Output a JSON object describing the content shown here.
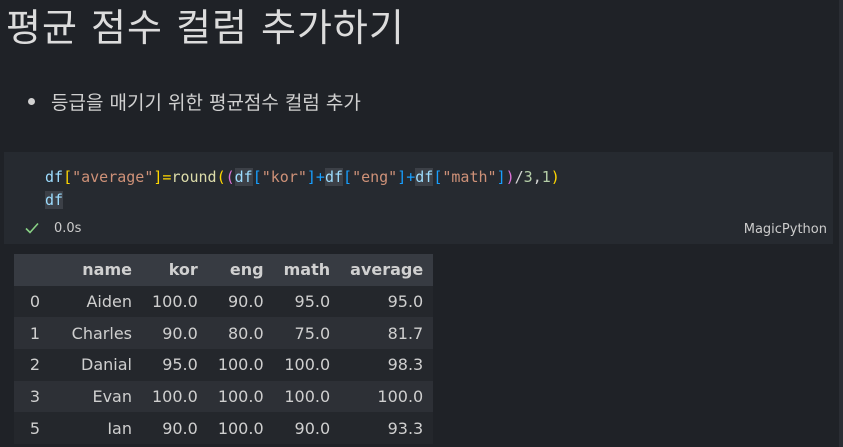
{
  "heading": "평균 점수 컬럼 추가하기",
  "bullet": "등급을 매기기 위한 평균점수 컬럼 추가",
  "cell": {
    "code_line1": {
      "t1": "df",
      "t2": "[",
      "t3": "\"average\"",
      "t4": "]=",
      "t5": "round",
      "t6": "(",
      "t7": "(",
      "t8": "df",
      "t9": "[",
      "t10": "\"kor\"",
      "t11": "]+",
      "t12": "df",
      "t13": "[",
      "t14": "\"eng\"",
      "t15": "]+",
      "t16": "df",
      "t17": "[",
      "t18": "\"math\"",
      "t19": "]",
      "t20": ")",
      "t21": "/",
      "t22": "3",
      "t23": ",",
      "t24": "1",
      "t25": ")"
    },
    "code_line2": "df",
    "exec_time": "0.0s",
    "language": "MagicPython"
  },
  "table": {
    "columns": [
      "",
      "name",
      "kor",
      "eng",
      "math",
      "average"
    ],
    "rows": [
      [
        "0",
        "Aiden",
        "100.0",
        "90.0",
        "95.0",
        "95.0"
      ],
      [
        "1",
        "Charles",
        "90.0",
        "80.0",
        "75.0",
        "81.7"
      ],
      [
        "2",
        "Danial",
        "95.0",
        "100.0",
        "100.0",
        "98.3"
      ],
      [
        "3",
        "Evan",
        "100.0",
        "100.0",
        "100.0",
        "100.0"
      ],
      [
        "5",
        "Ian",
        "90.0",
        "100.0",
        "90.0",
        "93.3"
      ]
    ]
  },
  "icons": {
    "status": "check-icon"
  },
  "colors": {
    "check": "#89d185",
    "string": "#ce9178",
    "variable": "#9cdcfe",
    "function": "#dcdcaa"
  }
}
